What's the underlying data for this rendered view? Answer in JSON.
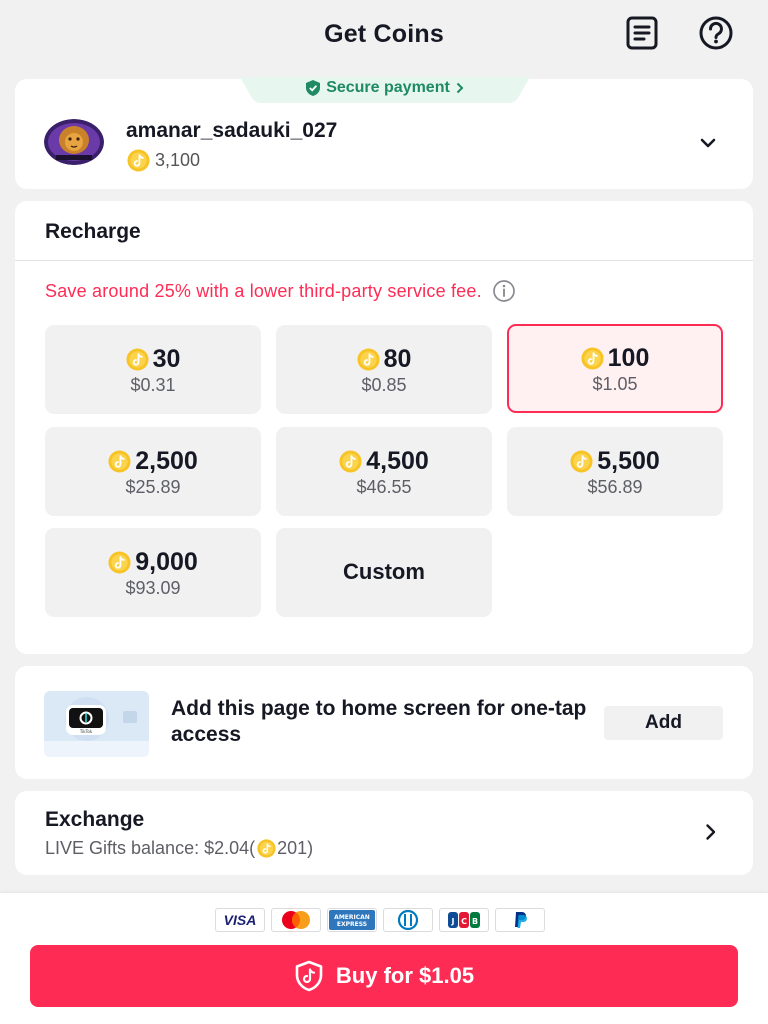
{
  "header": {
    "title": "Get Coins"
  },
  "account": {
    "secure_label": "Secure payment",
    "username": "amanar_sadauki_027",
    "balance": "3,100"
  },
  "recharge": {
    "title": "Recharge",
    "promo": "Save around 25% with a lower third-party service fee.",
    "packages": [
      {
        "coins": "30",
        "price": "$0.31",
        "selected": false
      },
      {
        "coins": "80",
        "price": "$0.85",
        "selected": false
      },
      {
        "coins": "100",
        "price": "$1.05",
        "selected": true
      },
      {
        "coins": "2,500",
        "price": "$25.89",
        "selected": false
      },
      {
        "coins": "4,500",
        "price": "$46.55",
        "selected": false
      },
      {
        "coins": "5,500",
        "price": "$56.89",
        "selected": false
      },
      {
        "coins": "9,000",
        "price": "$93.09",
        "selected": false
      }
    ],
    "custom_label": "Custom"
  },
  "homescreen": {
    "text": "Add this page to home screen for one-tap access",
    "add_label": "Add"
  },
  "exchange": {
    "title": "Exchange",
    "sub_prefix": "LIVE Gifts balance: $2.04(",
    "sub_coins": "201",
    "sub_suffix": ")"
  },
  "payment_methods": [
    "VISA",
    "Mastercard",
    "American Express",
    "Diners Club",
    "JCB",
    "PayPal"
  ],
  "buy_label": "Buy for $1.05",
  "colors": {
    "accent": "#fe2c55",
    "secure": "#1f8a64",
    "coin": "#f7c325"
  }
}
